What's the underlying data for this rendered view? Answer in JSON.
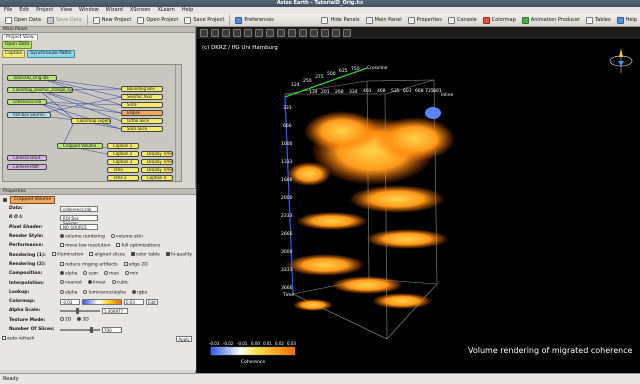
{
  "window_title": "Avizo Earth - TutorialD_Orig.hx",
  "menu": [
    "File",
    "Edit",
    "Project",
    "View",
    "Window",
    "Wizard",
    "XScreen",
    "XLearn",
    "Help"
  ],
  "toolbar": {
    "open_data": "Open Data",
    "save_data": "Save Data",
    "new_project": "New Project",
    "open_project": "Open Project",
    "save_project": "Save Project",
    "preferences": "Preferences",
    "hide_panels": "Hide Panels",
    "main_panel": "Main Panel",
    "properties": "Properties",
    "console": "Console",
    "colormap": "Colormap",
    "animation_producer": "Animation Producer",
    "tables": "Tables",
    "help": "Help"
  },
  "left": {
    "main_panel_title": "Main Panel",
    "project_view_tab": "Project View",
    "open_data_button": "Open Data",
    "caption_button": "Caption",
    "synchronize_button": "Synchronize Paths"
  },
  "graph_nodes": [
    {
      "label": "TutorialD_Orig.lda",
      "kind": "g"
    },
    {
      "label": "Colormap_seismic_orange_sy...",
      "kind": "g"
    },
    {
      "label": "coherence.lda",
      "kind": "g"
    },
    {
      "label": "ROI Box Seismic",
      "kind": "c"
    },
    {
      "label": "Colormap Legend",
      "kind": "y"
    },
    {
      "label": "Bounding Box",
      "kind": "y"
    },
    {
      "label": "Seismic Axis",
      "kind": "y"
    },
    {
      "label": "Slice",
      "kind": "y"
    },
    {
      "label": "Ellipse",
      "kind": "o"
    },
    {
      "label": "Ortho Slice",
      "kind": "y"
    },
    {
      "label": "Slice Slice",
      "kind": "y"
    },
    {
      "label": "Cropped Volume",
      "kind": "g"
    },
    {
      "label": "Camera-Orbit",
      "kind": "p"
    },
    {
      "label": "Camera-Path",
      "kind": "p"
    },
    {
      "label": "Caption 1",
      "kind": "y"
    },
    {
      "label": "Caption 2",
      "kind": "y"
    },
    {
      "label": "Caption 3",
      "kind": "y"
    },
    {
      "label": "Display Time",
      "kind": "y"
    },
    {
      "label": "Display Time 2",
      "kind": "y"
    },
    {
      "label": "Time",
      "kind": "y"
    },
    {
      "label": "Time 2",
      "kind": "y"
    },
    {
      "label": "Display Time 3",
      "kind": "y"
    },
    {
      "label": "Caption 4",
      "kind": "y"
    }
  ],
  "properties": {
    "panel_title": "Properties",
    "module": "Cropped Volume",
    "data_label": "Data:",
    "data_value": "coherence.lda",
    "roi_label": "R O I:",
    "roi_value": "ROI Box Seismic",
    "pixel_shader_label": "Pixel Shader:",
    "pixel_shader_value": "NO SOURCE",
    "render_style_label": "Render Style:",
    "render_style_options": [
      "volume rendering",
      "volume skin"
    ],
    "performance_label": "Performance:",
    "performance_options": [
      "move low resolution",
      "full optimizations"
    ],
    "rendering1_label": "Rendering (1):",
    "rendering1_options": [
      "illumination",
      "aligned slices",
      "color table",
      "hi-quality"
    ],
    "rendering2_label": "Rendering (2):",
    "rendering2_options": [
      "reduce ringing artifacts",
      "edge 2D"
    ],
    "composition_label": "Composition:",
    "composition_options": [
      "alpha",
      "sum",
      "max",
      "min"
    ],
    "interpolation_label": "Interpolation:",
    "interpolation_options": [
      "nearest",
      "linear",
      "cubic"
    ],
    "lookup_label": "Lookup:",
    "lookup_options": [
      "alpha",
      "luminance/alpha",
      "rgba"
    ],
    "colormap_label": "Colormap:",
    "colormap_min": "-0.03",
    "colormap_max": "0.03",
    "colormap_edit": "Edit",
    "alpha_scale_label": "Alpha Scale:",
    "alpha_scale_value": "1.406977",
    "texture_mode_label": "Texture Mode:",
    "texture_mode_options": [
      "2D",
      "3D"
    ],
    "slices_label": "Number Of Slices:",
    "slices_value": "700",
    "auto_refresh": "auto refresh",
    "apply": "Apply"
  },
  "viewer": {
    "credit": "(c) DKRZ / IfG Uni Hamburg",
    "crossline_label": "Crossline",
    "inline_label": "Inline",
    "time_label": "Time",
    "caption": "Volume rendering of migrated coherence",
    "legend_title": "Coherence",
    "legend_ticks": [
      "-0.03",
      "-0.02",
      "-0.01",
      "0.00",
      "0.01",
      "0.02",
      "0.03"
    ],
    "crossline_ticks": [
      "134",
      "201",
      "268",
      "334",
      "401",
      "468",
      "535",
      "601",
      "668",
      "735",
      "801"
    ],
    "inline_ticks": [
      "124",
      "250",
      "375",
      "500",
      "625",
      "750"
    ],
    "time_ticks": [
      "333",
      "666",
      "1000",
      "1333",
      "1666",
      "2000",
      "2333",
      "2666",
      "3000",
      "3333",
      "3666"
    ]
  },
  "status": "Ready"
}
